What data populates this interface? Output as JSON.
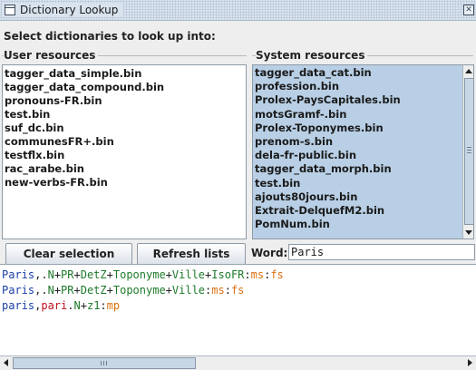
{
  "window": {
    "title": "Dictionary Lookup",
    "close_glyph": "✕"
  },
  "heading": "Select dictionaries to look up into:",
  "user_resources": {
    "label": "User resources",
    "items": [
      "tagger_data_simple.bin",
      "tagger_data_compound.bin",
      "pronouns-FR.bin",
      "test.bin",
      "suf_dc.bin",
      "communesFR+.bin",
      "testflx.bin",
      "rac_arabe.bin",
      "new-verbs-FR.bin"
    ]
  },
  "system_resources": {
    "label": "System resources",
    "items": [
      "tagger_data_cat.bin",
      "profession.bin",
      "Prolex-PaysCapitales.bin",
      "motsGramf-.bin",
      "Prolex-Toponymes.bin",
      "prenom-s.bin",
      "dela-fr-public.bin",
      "tagger_data_morph.bin",
      "test.bin",
      "ajouts80jours.bin",
      "Extrait-DelquefM2.bin",
      "PomNum.bin"
    ]
  },
  "buttons": {
    "clear": "Clear selection",
    "refresh": "Refresh lists"
  },
  "word": {
    "label": "Word:",
    "value": "Paris"
  },
  "colors": {
    "form": "#1a3fa8",
    "lemma": "#c1121f",
    "code": "#1d7a2a",
    "inflection": "#d9700f",
    "punct": "#222222"
  },
  "results": [
    [
      [
        "Paris",
        "form"
      ],
      [
        ",.",
        ""
      ],
      [
        "N",
        "code"
      ],
      [
        "+",
        ""
      ],
      [
        "PR",
        "code"
      ],
      [
        "+",
        ""
      ],
      [
        "DetZ",
        "code"
      ],
      [
        "+",
        ""
      ],
      [
        "Toponyme",
        "code"
      ],
      [
        "+",
        ""
      ],
      [
        "Ville",
        "code"
      ],
      [
        "+",
        ""
      ],
      [
        "IsoFR",
        "code"
      ],
      [
        ":",
        ""
      ],
      [
        "ms",
        "inflection"
      ],
      [
        ":",
        ""
      ],
      [
        "fs",
        "inflection"
      ]
    ],
    [
      [
        "Paris",
        "form"
      ],
      [
        ",.",
        ""
      ],
      [
        "N",
        "code"
      ],
      [
        "+",
        ""
      ],
      [
        "PR",
        "code"
      ],
      [
        "+",
        ""
      ],
      [
        "DetZ",
        "code"
      ],
      [
        "+",
        ""
      ],
      [
        "Toponyme",
        "code"
      ],
      [
        "+",
        ""
      ],
      [
        "Ville",
        "code"
      ],
      [
        ":",
        ""
      ],
      [
        "ms",
        "inflection"
      ],
      [
        ":",
        ""
      ],
      [
        "fs",
        "inflection"
      ]
    ],
    [
      [
        "paris",
        "form"
      ],
      [
        ",",
        ""
      ],
      [
        "pari",
        "lemma"
      ],
      [
        ".",
        ""
      ],
      [
        "N",
        "code"
      ],
      [
        "+",
        ""
      ],
      [
        "z1",
        "code"
      ],
      [
        ":",
        ""
      ],
      [
        "mp",
        "inflection"
      ]
    ]
  ]
}
